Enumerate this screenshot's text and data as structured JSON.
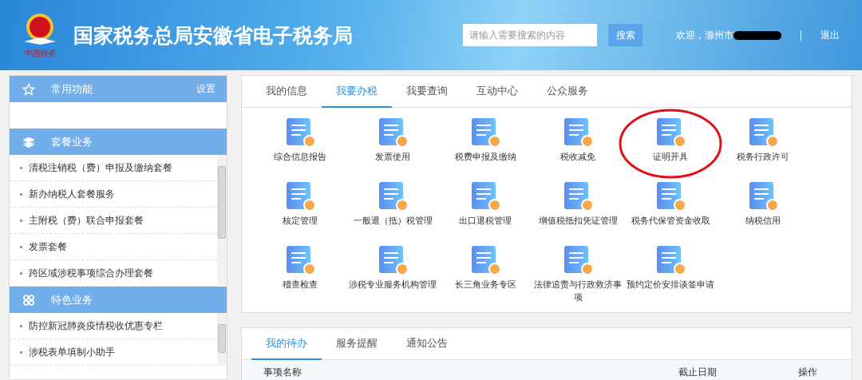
{
  "header": {
    "title": "国家税务总局安徽省电子税务局",
    "logo_caption": "中国税务",
    "search": {
      "placeholder": "请输入需要搜索的内容",
      "button": "搜索"
    },
    "welcome": "欢迎，滁州市",
    "user_redacted": true,
    "logout": "退出"
  },
  "sidebar": {
    "sections": [
      {
        "kind": "star",
        "title": "常用功能",
        "action": "设置"
      },
      {
        "kind": "layers",
        "title": "套餐业务",
        "items": [
          "清税注销税（费）申报及缴纳套餐",
          "新办纳税人套餐服务",
          "主附税（费）联合申报套餐",
          "发票套餐",
          "跨区域涉税事项综合办理套餐"
        ]
      },
      {
        "kind": "clover",
        "title": "特色业务",
        "items": [
          "防控新冠肺炎疫情税收优惠专栏",
          "涉税表单填制小助手"
        ]
      }
    ]
  },
  "main_tabs": [
    {
      "label": "我的信息",
      "selected": false
    },
    {
      "label": "我要办税",
      "selected": true
    },
    {
      "label": "我要查询",
      "selected": false
    },
    {
      "label": "互动中心",
      "selected": false
    },
    {
      "label": "公众服务",
      "selected": false
    }
  ],
  "services": [
    {
      "label": "综合信息报告",
      "circled": false
    },
    {
      "label": "发票使用",
      "circled": false
    },
    {
      "label": "税费申报及缴纳",
      "circled": false
    },
    {
      "label": "税收减免",
      "circled": false
    },
    {
      "label": "证明开具",
      "circled": true
    },
    {
      "label": "税务行政许可",
      "circled": false
    },
    {
      "label": "核定管理",
      "circled": false
    },
    {
      "label": "一般退（抵）税管理",
      "circled": false
    },
    {
      "label": "出口退税管理",
      "circled": false
    },
    {
      "label": "增值税抵扣凭证管理",
      "circled": false
    },
    {
      "label": "税务代保管资金收取",
      "circled": false
    },
    {
      "label": "纳税信用",
      "circled": false
    },
    {
      "label": "稽查检查",
      "circled": false
    },
    {
      "label": "涉税专业服务机构管理",
      "circled": false
    },
    {
      "label": "长三角业务专区",
      "circled": false
    },
    {
      "label": "法律追责与行政救济事项",
      "circled": false
    },
    {
      "label": "预约定价安排谈签申请",
      "circled": false
    }
  ],
  "todo_tabs": [
    {
      "label": "我的待办",
      "selected": true
    },
    {
      "label": "服务提醒",
      "selected": false
    },
    {
      "label": "通知公告",
      "selected": false
    }
  ],
  "todo_table": {
    "columns": [
      "事项名称",
      "截止日期",
      "操作"
    ]
  }
}
